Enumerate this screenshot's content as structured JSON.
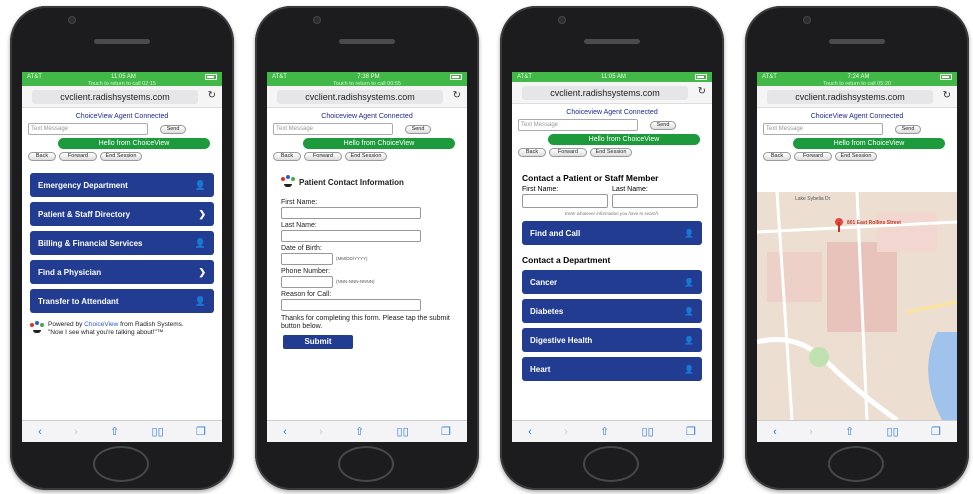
{
  "common": {
    "url": "cvclient.radishsystems.com",
    "carrier": "AT&T",
    "agent_connected_1": "ChoiceView Agent Connected",
    "agent_connected_2": "Choiceview Agent Connected",
    "text_placeholder": "Text Message",
    "send": "Send",
    "hello": "Hello from ChoiceView",
    "back": "Back",
    "forward": "Forward",
    "end_session": "End Session"
  },
  "phones": [
    {
      "time": "11:05 AM",
      "banner": "Touch to return to call 02:15",
      "menu": [
        {
          "label": "Emergency Department",
          "icon": "person-icon"
        },
        {
          "label": "Patient & Staff Directory",
          "icon": "chevron-right-icon"
        },
        {
          "label": "Billing & Financial Services",
          "icon": "person-icon"
        },
        {
          "label": "Find a Physician",
          "icon": "chevron-right-icon"
        },
        {
          "label": "Transfer to Attendant",
          "icon": "person-icon"
        }
      ],
      "powered_pre": "Powered by ",
      "powered_link": "ChoiceView",
      "powered_post": " from Radish Systems.",
      "tagline": "\"Now I see what you're talking about!\"™"
    },
    {
      "time": "7:38 PM",
      "banner": "Touch to return to call 00:55",
      "form_title": "Patient Contact Information",
      "first_name": "First Name:",
      "last_name": "Last Name:",
      "dob": "Date of Birth:",
      "dob_hint": "(MM/DD/YYYY)",
      "phone": "Phone Number:",
      "phone_hint": "(NNN-NNN-NNNN)",
      "reason": "Reason for Call:",
      "thanks": "Thanks for completing this form. Please tap the submit button below.",
      "submit": "Submit"
    },
    {
      "time": "11:05 AM",
      "contact_heading": "Contact a Patient or Staff Member",
      "first_name": "First Name:",
      "last_name": "Last Name:",
      "enter_hint": "Enter whatever information you have to search.",
      "find_call": "Find and Call",
      "dept_heading": "Contact a Department",
      "departments": [
        "Cancer",
        "Diabetes",
        "Digestive Health",
        "Heart"
      ]
    },
    {
      "time": "7:24 AM",
      "banner": "Touch to return to call 05:20",
      "map_pin_label": "801 East Rollins Street",
      "street_label": "Lake Sybelia Dr"
    }
  ]
}
